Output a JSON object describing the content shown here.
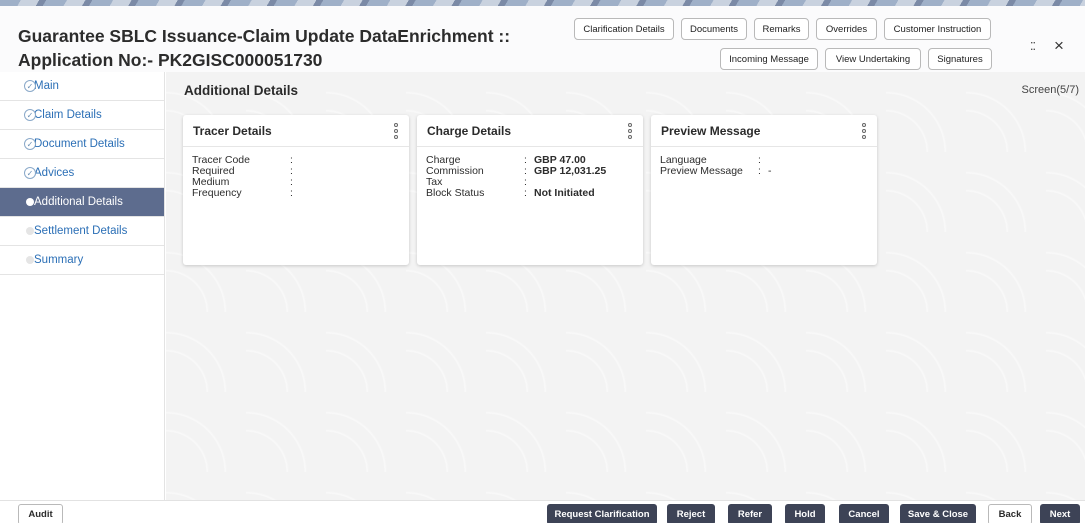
{
  "header": {
    "title_line1": "Guarantee SBLC Issuance-Claim Update DataEnrichment ::",
    "title_line2": "Application No:- PK2GISC000051730",
    "buttons_row1": [
      "Clarification Details",
      "Documents",
      "Remarks",
      "Overrides",
      "Customer Instruction"
    ],
    "buttons_row2": [
      "Incoming Message",
      "View Undertaking",
      "Signatures"
    ],
    "collapse_icon": "collapse-arrows-icon",
    "close_icon": "close-icon",
    "close_glyph": "×",
    "collapse_glyph": "⁚⁚"
  },
  "sidebar": {
    "items": [
      {
        "label": "Main",
        "state": "done"
      },
      {
        "label": "Claim Details",
        "state": "done"
      },
      {
        "label": "Document Details",
        "state": "done"
      },
      {
        "label": "Advices",
        "state": "done"
      },
      {
        "label": "Additional Details",
        "state": "active"
      },
      {
        "label": "Settlement Details",
        "state": "pending"
      },
      {
        "label": "Summary",
        "state": "pending"
      }
    ],
    "check_glyph": "✓"
  },
  "main": {
    "section_title": "Additional Details",
    "screen_count": "Screen(5/7)",
    "cards": [
      {
        "title": "Tracer Details",
        "rows": [
          {
            "key": "Tracer Code",
            "sep": ":",
            "value": ""
          },
          {
            "key": "Required",
            "sep": ":",
            "value": ""
          },
          {
            "key": "Medium",
            "sep": ":",
            "value": ""
          },
          {
            "key": "Frequency",
            "sep": ":",
            "value": ""
          }
        ]
      },
      {
        "title": "Charge Details",
        "rows": [
          {
            "key": "Charge",
            "sep": ":",
            "value": "GBP 47.00"
          },
          {
            "key": "Commission",
            "sep": ":",
            "value": "GBP 12,031.25"
          },
          {
            "key": "Tax",
            "sep": ":",
            "value": ""
          },
          {
            "key": "Block Status",
            "sep": ":",
            "value": "Not Initiated"
          }
        ]
      },
      {
        "title": "Preview Message",
        "rows": [
          {
            "key": "Language",
            "sep": ":",
            "value": ""
          },
          {
            "key": "Preview Message",
            "sep": ":",
            "value": "-"
          }
        ]
      }
    ]
  },
  "footer": {
    "audit": "Audit",
    "buttons": [
      "Request Clarification",
      "Reject",
      "Refer",
      "Hold",
      "Cancel",
      "Save & Close",
      "Back",
      "Next"
    ]
  },
  "colors": {
    "sidebar_active_bg": "#5d6c8e",
    "link_blue": "#2b6fb6",
    "footer_dark_button": "#3d4356"
  }
}
